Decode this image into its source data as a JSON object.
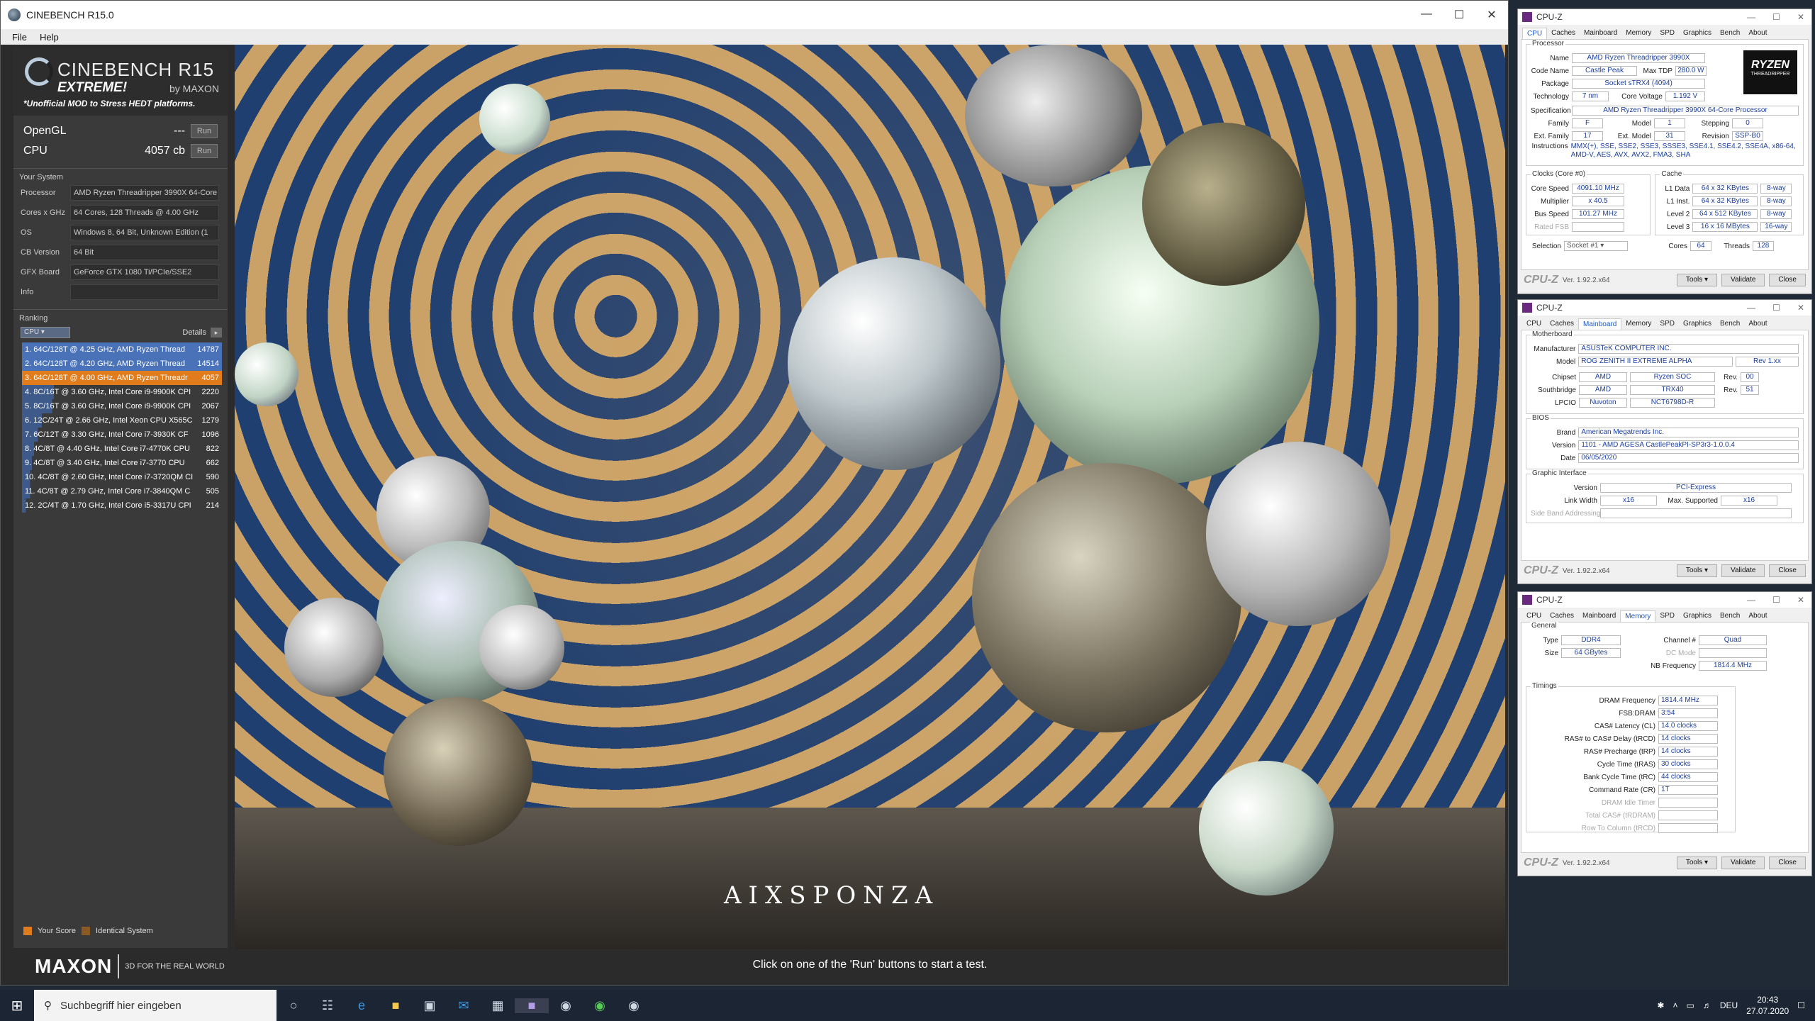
{
  "cinebench": {
    "title": "CINEBENCH R15.0",
    "menu": [
      "File",
      "Help"
    ],
    "logo": {
      "name": "CINEBENCH R15",
      "edition": "EXTREME!",
      "by": "by MAXON",
      "mod": "*Unofficial MOD to Stress HEDT platforms."
    },
    "scores": [
      {
        "label": "OpenGL",
        "value": "---",
        "run": "Run"
      },
      {
        "label": "CPU",
        "value": "4057 cb",
        "run": "Run"
      }
    ],
    "system_title": "Your System",
    "system": [
      {
        "key": "Processor",
        "value": "AMD Ryzen Threadripper 3990X 64-Core"
      },
      {
        "key": "Cores x GHz",
        "value": "64 Cores, 128 Threads @ 4.00 GHz"
      },
      {
        "key": "OS",
        "value": "Windows 8, 64 Bit, Unknown Edition (1"
      },
      {
        "key": "CB Version",
        "value": "64 Bit"
      },
      {
        "key": "GFX Board",
        "value": "GeForce GTX 1080 Ti/PCIe/SSE2"
      },
      {
        "key": "Info",
        "value": ""
      }
    ],
    "ranking_title": "Ranking",
    "ranking_filter": "CPU",
    "details_label": "Details",
    "ranking": [
      {
        "text": "1. 64C/128T @ 4.25 GHz, AMD Ryzen Thread",
        "score": "14787"
      },
      {
        "text": "2. 64C/128T @ 4.20 GHz, AMD Ryzen Thread",
        "score": "14514"
      },
      {
        "text": "3. 64C/128T @ 4.00 GHz, AMD Ryzen Threadr",
        "score": "4057"
      },
      {
        "text": "4. 8C/16T @ 3.60 GHz, Intel Core i9-9900K CPI",
        "score": "2220"
      },
      {
        "text": "5. 8C/16T @ 3.60 GHz, Intel Core i9-9900K CPI",
        "score": "2067"
      },
      {
        "text": "6. 12C/24T @ 2.66 GHz, Intel Xeon CPU X565C",
        "score": "1279"
      },
      {
        "text": "7. 6C/12T @ 3.30 GHz, Intel Core i7-3930K CF",
        "score": "1096"
      },
      {
        "text": "8. 4C/8T @ 4.40 GHz, Intel Core i7-4770K CPU",
        "score": "822"
      },
      {
        "text": "9. 4C/8T @ 3.40 GHz, Intel Core i7-3770 CPU",
        "score": "662"
      },
      {
        "text": "10. 4C/8T @ 2.60 GHz, Intel Core i7-3720QM CI",
        "score": "590"
      },
      {
        "text": "11. 4C/8T @ 2.79 GHz, Intel Core i7-3840QM C",
        "score": "505"
      },
      {
        "text": "12. 2C/4T @ 1.70 GHz, Intel Core i5-3317U CPI",
        "score": "214"
      }
    ],
    "legend": {
      "your_score": "Your Score",
      "identical": "Identical System"
    },
    "brand": {
      "maxon": "MAXON",
      "tagline": "3D FOR THE REAL WORLD"
    },
    "render_brand": "AIXSPONZA",
    "status": "Click on one of the 'Run' buttons to start a test."
  },
  "cpuz_cpu": {
    "title": "CPU-Z",
    "tabs": [
      "CPU",
      "Caches",
      "Mainboard",
      "Memory",
      "SPD",
      "Graphics",
      "Bench",
      "About"
    ],
    "active_tab": "CPU",
    "processor_title": "Processor",
    "name": "AMD Ryzen Threadripper 3990X",
    "code_name": "Castle Peak",
    "max_tdp": "280.0 W",
    "package": "Socket sTRX4 (4094)",
    "technology": "7 nm",
    "core_voltage": "1.192 V",
    "specification": "AMD Ryzen Threadripper 3990X 64-Core Processor",
    "family": "F",
    "model": "1",
    "stepping": "0",
    "ext_family": "17",
    "ext_model": "31",
    "revision": "SSP-B0",
    "instructions": "MMX(+), SSE, SSE2, SSE3, SSSE3, SSE4.1, SSE4.2, SSE4A, x86-64, AMD-V, AES, AVX, AVX2, FMA3, SHA",
    "clocks_title": "Clocks (Core #0)",
    "core_speed": "4091.10 MHz",
    "multiplier": "x 40.5",
    "bus_speed": "101.27 MHz",
    "rated_fsb": "",
    "cache_title": "Cache",
    "l1d": "64 x 32 KBytes",
    "l1d_way": "8-way",
    "l1i": "64 x 32 KBytes",
    "l1i_way": "8-way",
    "l2": "64 x 512 KBytes",
    "l2_way": "8-way",
    "l3": "16 x 16 MBytes",
    "l3_way": "16-way",
    "selection": "Socket #1",
    "cores": "64",
    "threads": "128",
    "labels": {
      "name": "Name",
      "code_name": "Code Name",
      "max_tdp": "Max TDP",
      "package": "Package",
      "technology": "Technology",
      "core_voltage": "Core Voltage",
      "specification": "Specification",
      "family": "Family",
      "model": "Model",
      "stepping": "Stepping",
      "ext_family": "Ext. Family",
      "ext_model": "Ext. Model",
      "revision": "Revision",
      "instructions": "Instructions",
      "core_speed": "Core Speed",
      "multiplier": "Multiplier",
      "bus_speed": "Bus Speed",
      "rated_fsb": "Rated FSB",
      "l1d": "L1 Data",
      "l1i": "L1 Inst.",
      "l2": "Level 2",
      "l3": "Level 3",
      "selection": "Selection",
      "cores": "Cores",
      "threads": "Threads"
    },
    "logo_badge": "RYZEN",
    "logo_sub": "THREADRIPPER"
  },
  "cpuz_mb": {
    "title": "CPU-Z",
    "active_tab": "Mainboard",
    "mb_title": "Motherboard",
    "manufacturer": "ASUSTeK COMPUTER INC.",
    "model": "ROG ZENITH II EXTREME ALPHA",
    "model_rev": "Rev 1.xx",
    "chipset_vendor": "AMD",
    "chipset": "Ryzen SOC",
    "chipset_rev": "00",
    "south_vendor": "AMD",
    "south": "TRX40",
    "south_rev": "51",
    "lpcio_vendor": "Nuvoton",
    "lpcio": "NCT6798D-R",
    "bios_title": "BIOS",
    "brand": "American Megatrends Inc.",
    "version": "1101 - AMD AGESA CastlePeakPI-SP3r3-1.0.0.4",
    "date": "06/05/2020",
    "gi_title": "Graphic Interface",
    "gi_version": "PCI-Express",
    "link_width": "x16",
    "max_supported": "x16",
    "labels": {
      "manufacturer": "Manufacturer",
      "model": "Model",
      "chipset": "Chipset",
      "southbridge": "Southbridge",
      "lpcio": "LPCIO",
      "rev": "Rev.",
      "brand": "Brand",
      "version": "Version",
      "date": "Date",
      "link_width": "Link Width",
      "max_supported": "Max. Supported",
      "sba": "Side Band Addressing"
    }
  },
  "cpuz_mem": {
    "title": "CPU-Z",
    "active_tab": "Memory",
    "general_title": "General",
    "type": "DDR4",
    "channel": "Quad",
    "size": "64 GBytes",
    "dc_mode": "",
    "nb_frequency": "1814.4 MHz",
    "timings_title": "Timings",
    "timings": [
      {
        "label": "DRAM Frequency",
        "value": "1814.4 MHz"
      },
      {
        "label": "FSB:DRAM",
        "value": "3:54"
      },
      {
        "label": "CAS# Latency (CL)",
        "value": "14.0 clocks"
      },
      {
        "label": "RAS# to CAS# Delay (tRCD)",
        "value": "14 clocks"
      },
      {
        "label": "RAS# Precharge (tRP)",
        "value": "14 clocks"
      },
      {
        "label": "Cycle Time (tRAS)",
        "value": "30 clocks"
      },
      {
        "label": "Bank Cycle Time (tRC)",
        "value": "44 clocks"
      },
      {
        "label": "Command Rate (CR)",
        "value": "1T"
      },
      {
        "label": "DRAM Idle Timer",
        "value": ""
      },
      {
        "label": "Total CAS# (tRDRAM)",
        "value": ""
      },
      {
        "label": "Row To Column (tRCD)",
        "value": ""
      }
    ],
    "labels": {
      "type": "Type",
      "channel": "Channel #",
      "size": "Size",
      "dc_mode": "DC Mode",
      "nb_frequency": "NB Frequency"
    }
  },
  "cpuz_footer": {
    "logo": "CPU-Z",
    "version": "Ver. 1.92.2.x64",
    "tools": "Tools",
    "validate": "Validate",
    "close": "Close"
  },
  "taskbar": {
    "search_placeholder": "Suchbegriff hier eingeben",
    "language": "DEU",
    "time": "20:43",
    "date": "27.07.2020"
  }
}
